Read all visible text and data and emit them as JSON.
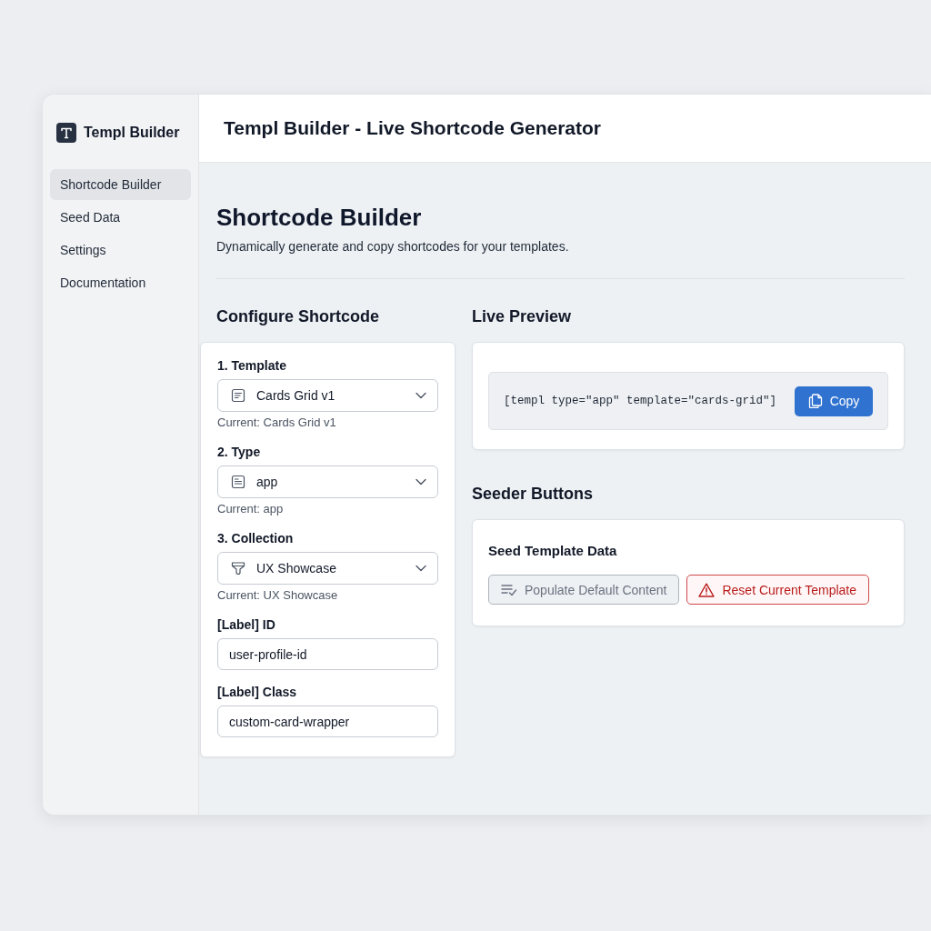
{
  "sidebar": {
    "brand": "Templ Builder",
    "items": [
      {
        "label": "Shortcode Builder",
        "selected": true
      },
      {
        "label": "Seed Data",
        "selected": false
      },
      {
        "label": "Settings",
        "selected": false
      },
      {
        "label": "Documentation",
        "selected": false
      }
    ]
  },
  "header": {
    "title": "Templ Builder - Live Shortcode Generator"
  },
  "page": {
    "title": "Shortcode Builder",
    "subtitle": "Dynamically generate and copy shortcodes for your templates."
  },
  "configure": {
    "heading": "Configure Shortcode",
    "fields": [
      {
        "kind": "select",
        "label": "1. Template",
        "value": "Cards Grid v1",
        "helper": "Current: Cards Grid v1"
      },
      {
        "kind": "select",
        "label": "2. Type",
        "value": "app",
        "helper": "Current: app"
      },
      {
        "kind": "select",
        "label": "3. Collection",
        "value": "UX Showcase",
        "helper": "Current: UX Showcase"
      },
      {
        "kind": "input",
        "label": "[Label] ID",
        "value": "user-profile-id"
      },
      {
        "kind": "input",
        "label": "[Label] Class",
        "value": "custom-card-wrapper"
      }
    ]
  },
  "preview": {
    "heading": "Live Preview",
    "code": "[templ type=\"app\" template=\"cards-grid\"]",
    "copy_button": "Copy"
  },
  "seeder": {
    "heading": "Seeder Buttons",
    "card_title": "Seed Template Data",
    "buttons": [
      {
        "kind": "secondary",
        "label": "Populate Default Content"
      },
      {
        "kind": "danger",
        "label": "Reset Current Template"
      }
    ]
  }
}
